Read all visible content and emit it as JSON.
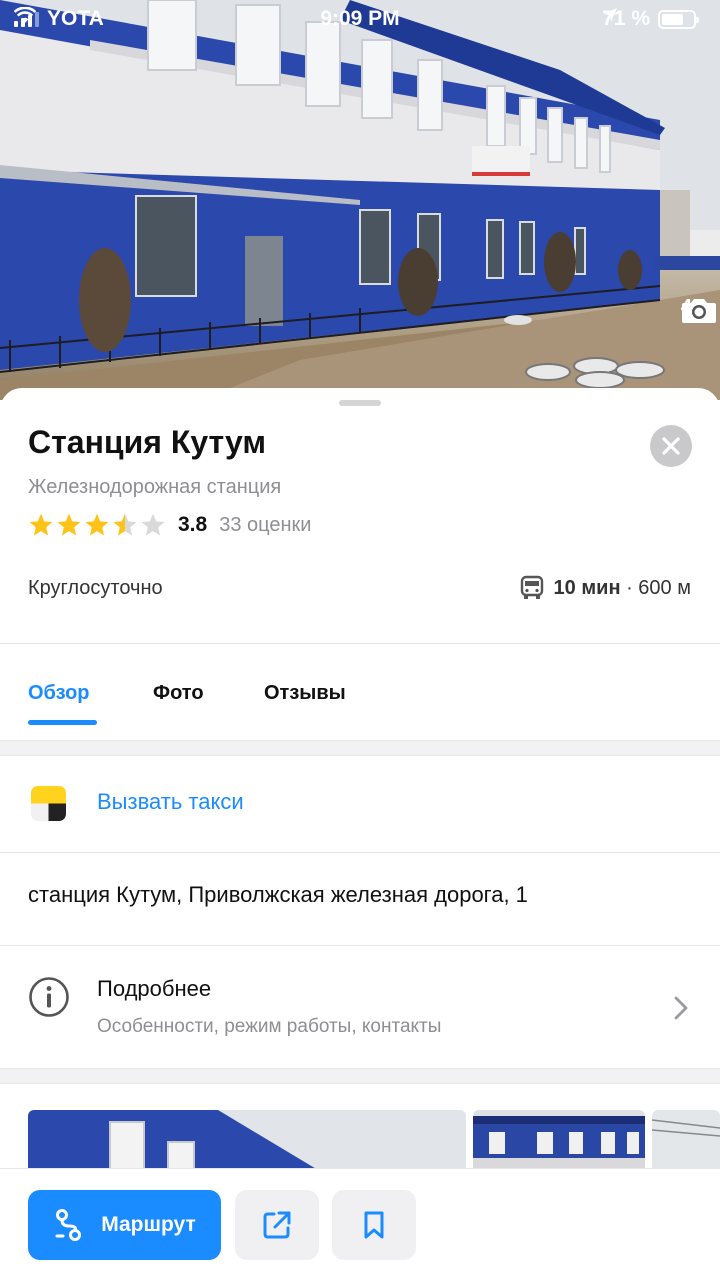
{
  "status_bar": {
    "carrier": "YOTA",
    "time": "9:09 PM",
    "battery_percent": "71 %",
    "battery_level": 0.71
  },
  "hero": {
    "photo_count": "4",
    "camera_icon": "camera-icon"
  },
  "place": {
    "title": "Станция Кутум",
    "category": "Железнодорожная станция",
    "rating_value": "3.8",
    "rating_stars": 3.5,
    "rating_count": "33 оценки",
    "hours": "Круглосуточно",
    "transit_time": "10 мин",
    "transit_distance": "· 600 м",
    "transit_icon": "bus-icon"
  },
  "tabs": [
    {
      "label": "Обзор",
      "active": true
    },
    {
      "label": "Фото",
      "active": false
    },
    {
      "label": "Отзывы",
      "active": false
    }
  ],
  "taxi": {
    "label": "Вызвать такси",
    "icon": "yandex-taxi-icon"
  },
  "address": "станция Кутум, Приволжская железная дорога, 1",
  "details": {
    "title": "Подробнее",
    "subtitle": "Особенности, режим работы, контакты",
    "icon": "info-icon"
  },
  "actions": {
    "route_label": "Маршрут",
    "share_icon": "share-icon",
    "bookmark_icon": "bookmark-icon"
  },
  "colors": {
    "accent": "#1a8cff",
    "star": "#fcc419",
    "star_empty": "#d9d9d9",
    "building_blue": "#2a45a8"
  }
}
